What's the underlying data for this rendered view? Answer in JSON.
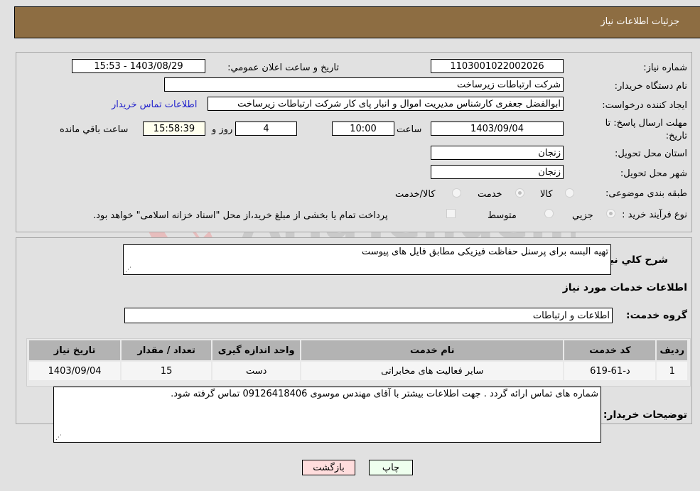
{
  "header": {
    "title": "جزئیات اطلاعات نیاز"
  },
  "form": {
    "need_number": {
      "label": "شماره نیاز:",
      "value": "1103001022002026"
    },
    "announce_datetime": {
      "label": "تاریخ و ساعت اعلان عمومي:",
      "value": "1403/08/29 - 15:53"
    },
    "buyer_org": {
      "label": "نام دستگاه خریدار:",
      "value": "شرکت ارتباطات زیرساخت"
    },
    "requester": {
      "label": "ایجاد کننده درخواست:",
      "value": "ابوالفضل جعفری کارشناس مدیریت اموال و انبار پای کار  شرکت ارتباطات زیرساخت"
    },
    "buyer_contact_link": "اطلاعات تماس خریدار",
    "deadline": {
      "label_line1": "مهلت ارسال پاسخ: تا",
      "label_line2": "تاریخ:",
      "date": "1403/09/04",
      "time_label": "ساعت",
      "time": "10:00",
      "days": "4",
      "days_label": "روز و",
      "remaining": "15:58:39",
      "remaining_label": "ساعت باقي مانده"
    },
    "province": {
      "label": "استان محل تحویل:",
      "value": "زنجان"
    },
    "city": {
      "label": "شهر محل تحویل:",
      "value": "زنجان"
    },
    "category": {
      "label": "طبقه بندی موضوعی:",
      "options": [
        "کالا",
        "خدمت",
        "کالا/خدمت"
      ],
      "selected": "خدمت"
    },
    "purchase_process": {
      "label": "نوع فرآیند خرید :",
      "options": [
        "جزیي",
        "متوسط"
      ],
      "selected": "جزیي",
      "treasury_note": "پرداخت تمام یا بخشی از مبلغ خرید،از محل \"اسناد خزانه اسلامی\" خواهد بود."
    }
  },
  "details": {
    "description_label": "شرح کلي نیاز:",
    "description": "تهیه البسه برای پرسنل حفاظت فیزیکی مطابق فایل های پیوست",
    "services_heading": "اطلاعات خدمات مورد نیاز",
    "service_group_label": "گروه خدمت:",
    "service_group": "اطلاعات و ارتباطات",
    "table": {
      "headers": [
        "ردیف",
        "کد خدمت",
        "نام خدمت",
        "واحد اندازه گیری",
        "تعداد / مقدار",
        "تاریخ نیاز"
      ],
      "rows": [
        [
          "1",
          "د-61-619",
          "سایر فعالیت های مخابراتی",
          "دست",
          "15",
          "1403/09/04"
        ]
      ]
    },
    "buyer_notes_label": "توضیحات خریدار:",
    "buyer_notes": "شماره های تماس ارائه گردد . جهت اطلاعات بیشتر با آقای مهندس موسوی 09126418406 تماس گرفته شود."
  },
  "buttons": {
    "print": "چاپ",
    "back": "بازگشت"
  },
  "colors": {
    "header_bg": "#8d6d42",
    "print_bg": "#eeffee",
    "back_bg": "#ffdddd",
    "link": "#2222cc"
  },
  "watermark": {
    "text": "AriaTender.neT"
  }
}
